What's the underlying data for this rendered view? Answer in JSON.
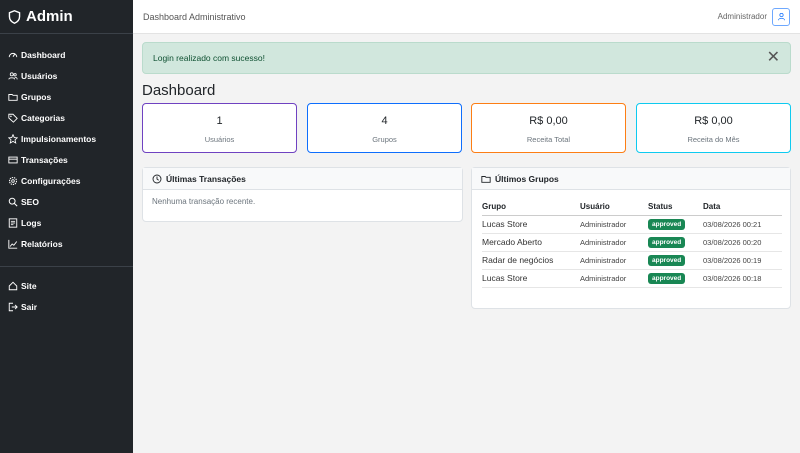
{
  "brand": {
    "name": "Admin"
  },
  "sidebar": {
    "items": [
      {
        "label": "Dashboard",
        "icon": "speedometer-icon"
      },
      {
        "label": "Usuários",
        "icon": "users-icon"
      },
      {
        "label": "Grupos",
        "icon": "folder-icon"
      },
      {
        "label": "Categorias",
        "icon": "tag-icon"
      },
      {
        "label": "Impulsionamentos",
        "icon": "star-icon"
      },
      {
        "label": "Transações",
        "icon": "card-icon"
      },
      {
        "label": "Configurações",
        "icon": "gear-icon"
      },
      {
        "label": "SEO",
        "icon": "search-icon"
      },
      {
        "label": "Logs",
        "icon": "document-icon"
      },
      {
        "label": "Relatórios",
        "icon": "graph-icon"
      }
    ],
    "bottom_items": [
      {
        "label": "Site",
        "icon": "house-icon"
      },
      {
        "label": "Sair",
        "icon": "logout-icon"
      }
    ]
  },
  "topbar": {
    "title": "Dashboard Administrativo",
    "user": "Administrador"
  },
  "alert": {
    "message": "Login realizado com sucesso!",
    "close": "✕"
  },
  "page": {
    "title": "Dashboard"
  },
  "stats": [
    {
      "value": "1",
      "label": "Usuários",
      "color": "#6f42c1"
    },
    {
      "value": "4",
      "label": "Grupos",
      "color": "#0d6efd"
    },
    {
      "value": "R$ 0,00",
      "label": "Receita Total",
      "color": "#fd7e14"
    },
    {
      "value": "R$ 0,00",
      "label": "Receita do Mês",
      "color": "#0dcaf0"
    }
  ],
  "transactions": {
    "title": "Últimas Transações",
    "empty": "Nenhuma transação recente."
  },
  "groups": {
    "title": "Últimos Grupos",
    "headers": [
      "Grupo",
      "Usuário",
      "Status",
      "Data"
    ],
    "rows": [
      {
        "group": "Lucas Store",
        "user": "Administrador",
        "status": "approved",
        "date": "03/08/2026 00:21"
      },
      {
        "group": "Mercado Aberto",
        "user": "Administrador",
        "status": "approved",
        "date": "03/08/2026 00:20"
      },
      {
        "group": "Radar de negócios",
        "user": "Administrador",
        "status": "approved",
        "date": "03/08/2026 00:19"
      },
      {
        "group": "Lucas Store",
        "user": "Administrador",
        "status": "approved",
        "date": "03/08/2026 00:18"
      }
    ]
  },
  "colors": {
    "sidebar_bg": "#212529",
    "alert_bg": "#d1e7dd",
    "badge_green": "#198754"
  }
}
